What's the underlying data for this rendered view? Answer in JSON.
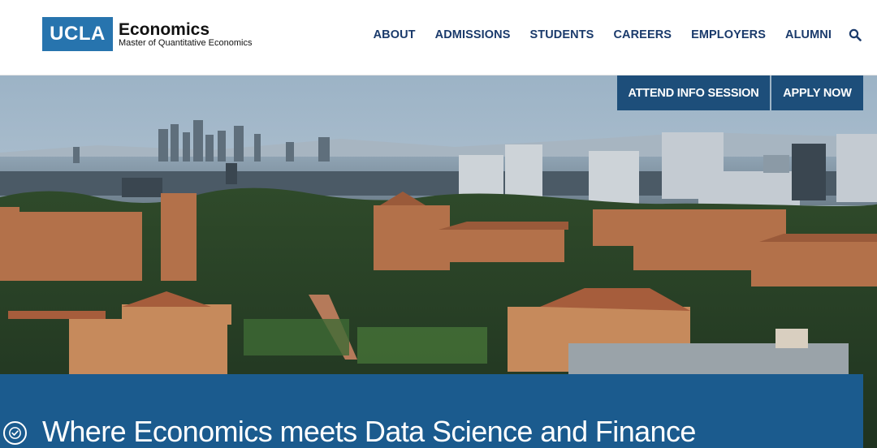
{
  "logo": {
    "mark": "UCLA",
    "title": "Economics",
    "subtitle": "Master of Quantitative Economics"
  },
  "nav": {
    "items": [
      {
        "label": "ABOUT"
      },
      {
        "label": "ADMISSIONS"
      },
      {
        "label": "STUDENTS"
      },
      {
        "label": "CAREERS"
      },
      {
        "label": "EMPLOYERS"
      },
      {
        "label": "ALUMNI"
      }
    ],
    "search_icon": "search-icon"
  },
  "hero": {
    "image": "campus-aerial-skyline",
    "cta_info": "ATTEND INFO SESSION",
    "cta_apply": "APPLY NOW",
    "headline": "Where Economics meets Data Science and Finance"
  },
  "accessibility": {
    "icon": "accessibility-icon"
  },
  "colors": {
    "brand_blue": "#2774ae",
    "nav_text": "#1a3a6b",
    "cta_bg": "#1d4e7a",
    "banner_bg": "#1b5b8e"
  }
}
